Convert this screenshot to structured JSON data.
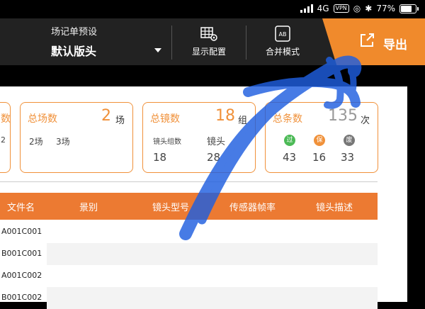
{
  "status": {
    "network": "4G",
    "vpn": "VPN",
    "battery": "77%",
    "battery_level": 0.77
  },
  "toolbar": {
    "preset_title": "场记单预设",
    "preset_value": "默认版头",
    "display_config": "显示配置",
    "merge_mode": "合并模式",
    "merge_icon_text": "AB",
    "export": "导出"
  },
  "cards": {
    "left_partial": {
      "title_tail": "数",
      "value_tail": "2"
    },
    "scenes": {
      "title": "总场数",
      "value": "2",
      "unit": "场",
      "detail_1": "2场",
      "detail_2": "3场"
    },
    "shots": {
      "title": "总镜数",
      "value": "18",
      "unit": "组",
      "sub_label_1": "镜头组数",
      "sub_label_2": "镜头",
      "sub_value_1": "18",
      "sub_value_2": "28"
    },
    "takes": {
      "title": "总条数",
      "value": "135",
      "unit": "次",
      "badge_pass": "过",
      "badge_keep": "保",
      "badge_other": "废",
      "count_pass": "43",
      "count_keep": "16",
      "count_other": "33"
    }
  },
  "table": {
    "headers": [
      "文件名",
      "景别",
      "镜头型号",
      "传感器帧率",
      "镜头描述"
    ],
    "rows": [
      "A001C001",
      "B001C001",
      "A001C002",
      "B001C002"
    ]
  },
  "colors": {
    "accent": "#f08a2c",
    "header": "#ec7a32",
    "scribble": "#1f5fe0"
  }
}
